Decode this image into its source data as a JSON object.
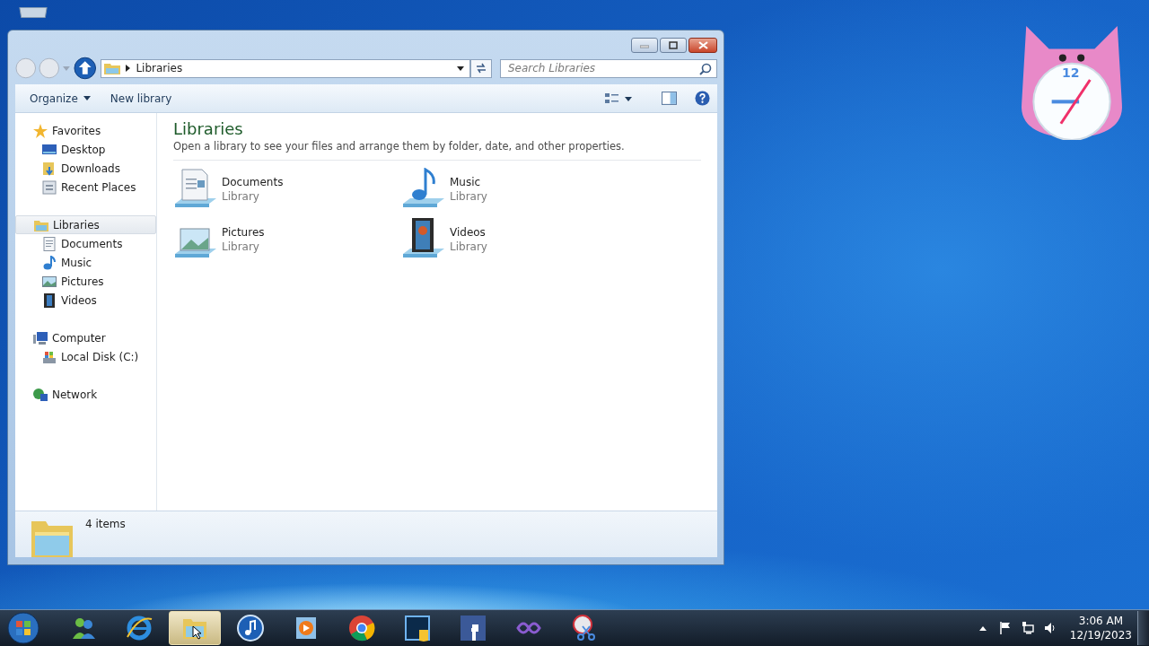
{
  "window": {
    "address": "Libraries",
    "search": {
      "placeholder": "Search Libraries"
    },
    "toolbar": [
      {
        "label": "Organize",
        "kind": "dropdown"
      },
      {
        "label": "New library",
        "kind": "button"
      }
    ],
    "sidebar": [
      {
        "label": "Favorites",
        "kind": "star",
        "selected": false,
        "children": [
          {
            "label": "Desktop",
            "kind": "desktop",
            "selected": false
          },
          {
            "label": "Downloads",
            "kind": "downloads",
            "selected": false
          },
          {
            "label": "Recent Places",
            "kind": "recent",
            "selected": false
          }
        ]
      },
      {
        "label": "Libraries",
        "kind": "libraries",
        "selected": true,
        "children": [
          {
            "label": "Documents",
            "kind": "documents",
            "selected": false
          },
          {
            "label": "Music",
            "kind": "music",
            "selected": false
          },
          {
            "label": "Pictures",
            "kind": "pictures",
            "selected": false
          },
          {
            "label": "Videos",
            "kind": "videos",
            "selected": false
          }
        ]
      },
      {
        "label": "Computer",
        "kind": "computer",
        "selected": false,
        "children": [
          {
            "label": "Local Disk (C:)",
            "kind": "disk",
            "selected": false
          }
        ]
      },
      {
        "label": "Network",
        "kind": "network",
        "selected": false
      }
    ],
    "content": {
      "title": "Libraries",
      "description": "Open a library to see your files and arrange them by folder, date, and other properties.",
      "items": [
        {
          "name": "Documents",
          "type": "Library",
          "kind": "documents"
        },
        {
          "name": "Music",
          "type": "Library",
          "kind": "music"
        },
        {
          "name": "Pictures",
          "type": "Library",
          "kind": "pictures"
        },
        {
          "name": "Videos",
          "type": "Library",
          "kind": "videos"
        }
      ]
    },
    "status": "4 items"
  },
  "gadget": {
    "clock_number": "12"
  },
  "taskbar": {
    "apps": [
      {
        "kind": "messenger",
        "selected": false
      },
      {
        "kind": "browser",
        "selected": false
      },
      {
        "kind": "explorer",
        "selected": true
      },
      {
        "kind": "music",
        "selected": false
      },
      {
        "kind": "media",
        "selected": false
      },
      {
        "kind": "chrome",
        "selected": false
      },
      {
        "kind": "photo",
        "selected": false
      },
      {
        "kind": "social",
        "selected": false
      },
      {
        "kind": "infinity",
        "selected": false
      },
      {
        "kind": "snip",
        "selected": false
      }
    ],
    "time": "3:06 AM",
    "date": "12/19/2023"
  }
}
